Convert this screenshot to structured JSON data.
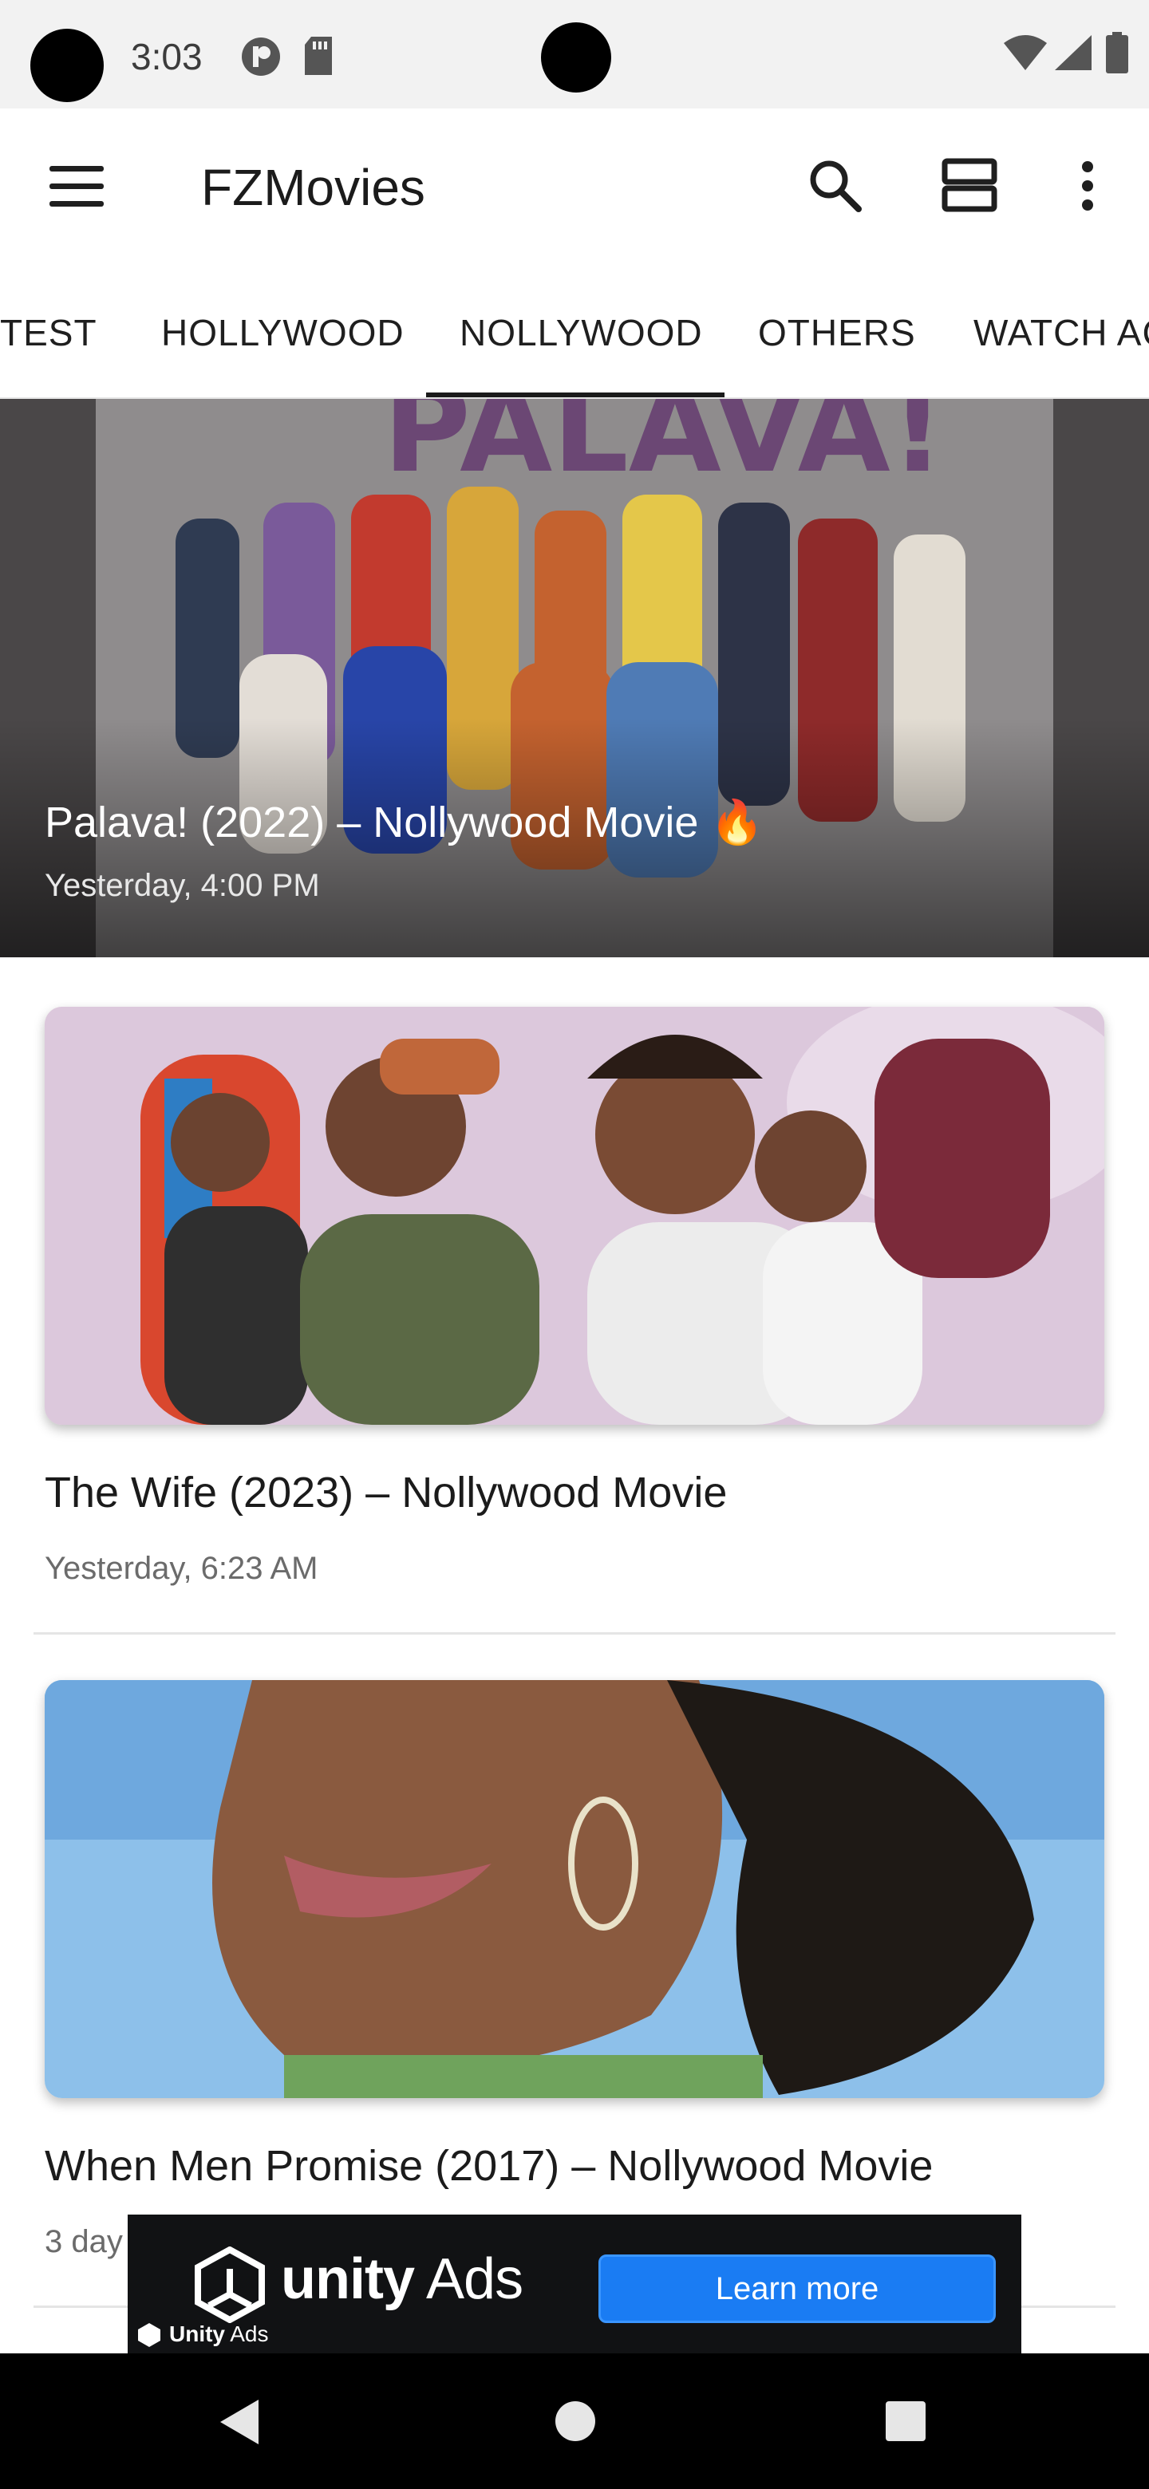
{
  "status_bar": {
    "time": "3:03"
  },
  "app_bar": {
    "title": "FZMovies"
  },
  "tabs": [
    {
      "label": "TEST"
    },
    {
      "label": "HOLLYWOOD"
    },
    {
      "label": "NOLLYWOOD",
      "selected": true
    },
    {
      "label": "OTHERS"
    },
    {
      "label": "WATCH AC"
    }
  ],
  "hero": {
    "title": "Palava! (2022) – Nollywood Movie 🔥",
    "date": "Yesterday, 4:00 PM"
  },
  "posts": [
    {
      "title": "The Wife (2023) – Nollywood Movie",
      "date": "Yesterday, 6:23 AM"
    },
    {
      "title": "When Men Promise (2017) – Nollywood Movie",
      "date": "3 day"
    }
  ],
  "ad": {
    "brand_bold": "unity",
    "brand_light": " Ads",
    "button_label": "Learn more",
    "small_bold": "Unity",
    "small_light": " Ads"
  },
  "colors": {
    "accent": "#1b1b1b",
    "ad_button": "#1a7cf3"
  }
}
